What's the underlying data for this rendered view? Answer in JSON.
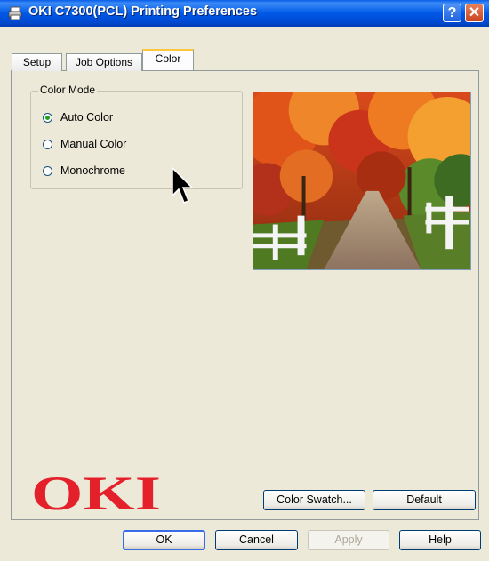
{
  "window": {
    "title": "OKI C7300(PCL) Printing Preferences",
    "help_glyph": "?",
    "close_glyph": "✕"
  },
  "tabs": [
    {
      "label": "Setup",
      "active": false
    },
    {
      "label": "Job Options",
      "active": false
    },
    {
      "label": "Color",
      "active": true
    }
  ],
  "color_mode": {
    "group_label": "Color Mode",
    "options": [
      {
        "label": "Auto Color",
        "checked": true
      },
      {
        "label": "Manual Color",
        "checked": false
      },
      {
        "label": "Monochrome",
        "checked": false
      }
    ]
  },
  "logo": {
    "text": "OKI",
    "color": "#e4202a"
  },
  "panel_buttons": {
    "swatch": "Color Swatch...",
    "default": "Default"
  },
  "footer_buttons": {
    "ok": "OK",
    "cancel": "Cancel",
    "apply": "Apply",
    "help": "Help"
  },
  "icons": {
    "title_icon": "printer-icon",
    "cursor": "mouse-pointer-icon"
  }
}
